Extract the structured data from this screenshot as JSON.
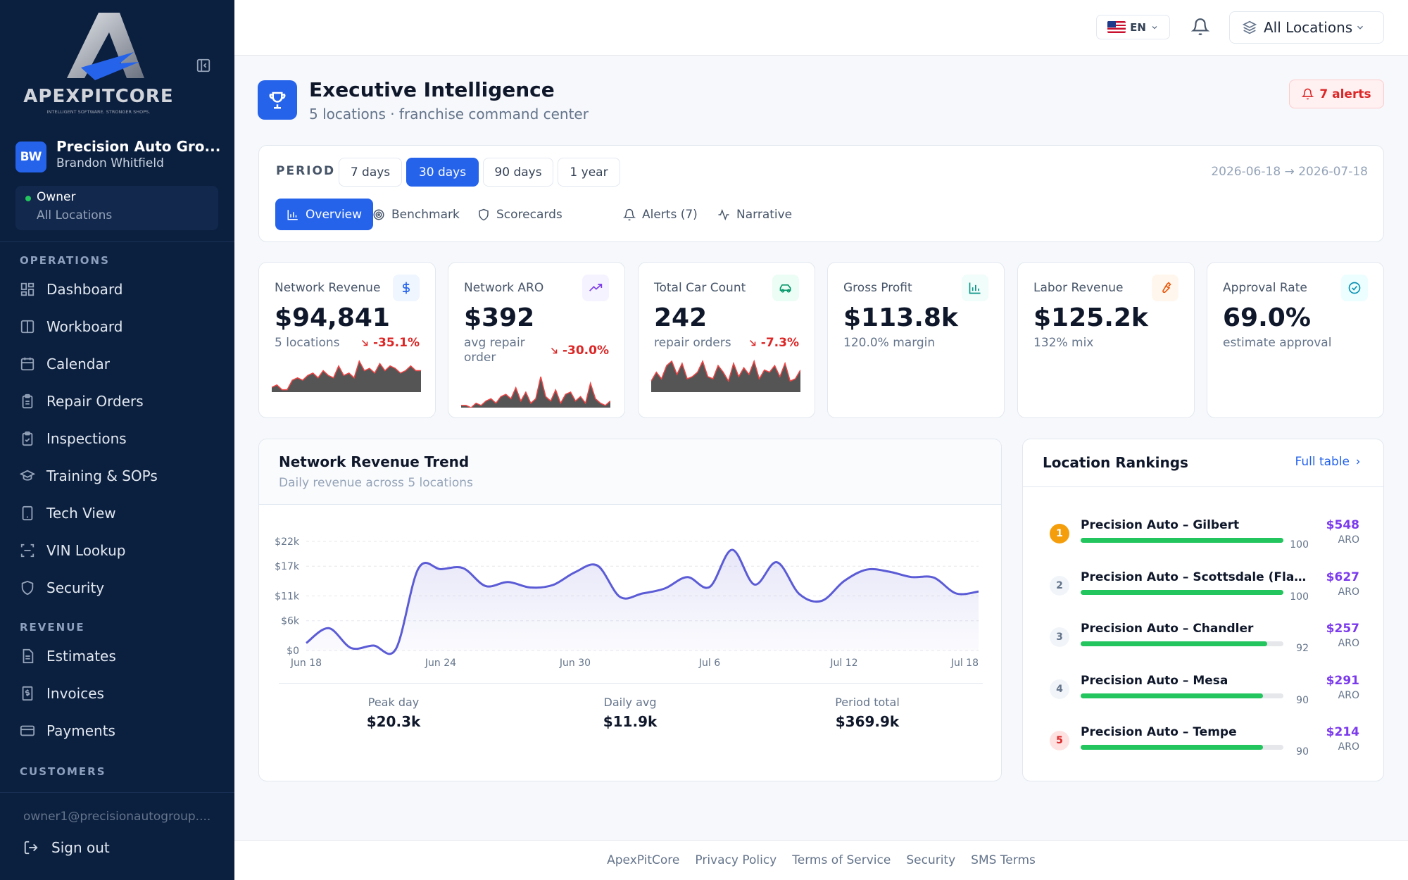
{
  "brand": {
    "name": "APEXPITCORE",
    "tagline": "INTELLIGENT SOFTWARE. STRONGER SHOPS."
  },
  "org": {
    "initials": "BW",
    "name": "Precision Auto Gro...",
    "user": "Brandon Whitfield",
    "role": "Owner",
    "scope": "All Locations"
  },
  "nav": {
    "operations_label": "OPERATIONS",
    "operations": [
      {
        "label": "Dashboard",
        "icon": "dashboard-icon"
      },
      {
        "label": "Workboard",
        "icon": "workboard-icon"
      },
      {
        "label": "Calendar",
        "icon": "calendar-icon"
      },
      {
        "label": "Repair Orders",
        "icon": "clipboard-icon"
      },
      {
        "label": "Inspections",
        "icon": "clipboard-check-icon"
      },
      {
        "label": "Training & SOPs",
        "icon": "graduation-cap-icon"
      },
      {
        "label": "Tech View",
        "icon": "tablet-icon"
      },
      {
        "label": "VIN Lookup",
        "icon": "scan-icon"
      },
      {
        "label": "Security",
        "icon": "shield-icon"
      }
    ],
    "revenue_label": "REVENUE",
    "revenue": [
      {
        "label": "Estimates",
        "icon": "document-icon"
      },
      {
        "label": "Invoices",
        "icon": "receipt-icon"
      },
      {
        "label": "Payments",
        "icon": "credit-card-icon"
      }
    ],
    "customers_label": "CUSTOMERS"
  },
  "account": {
    "email": "owner1@precisionautogroup....",
    "signout": "Sign out"
  },
  "topbar": {
    "lang": "EN",
    "locations": "All Locations"
  },
  "header": {
    "title": "Executive Intelligence",
    "subtitle": "5 locations · franchise command center",
    "alerts": "7 alerts"
  },
  "period": {
    "label": "PERIOD",
    "options": [
      "7 days",
      "30 days",
      "90 days",
      "1 year"
    ],
    "selected": "30 days",
    "range": "2026-06-18 → 2026-07-18"
  },
  "tabs": [
    {
      "label": "Overview",
      "active": true
    },
    {
      "label": "Benchmark"
    },
    {
      "label": "Scorecards"
    },
    {
      "label": "Alerts (7)"
    },
    {
      "label": "Narrative"
    }
  ],
  "kpis": [
    {
      "label": "Network Revenue",
      "value": "$94,841",
      "sub": "5 locations",
      "change": "-35.1%",
      "icon": "dollar-icon",
      "color": "#2563eb"
    },
    {
      "label": "Network ARO",
      "value": "$392",
      "sub": "avg repair order",
      "change": "-30.0%",
      "icon": "trending-up-icon",
      "color": "#7c3aed"
    },
    {
      "label": "Total Car Count",
      "value": "242",
      "sub": "repair orders",
      "change": "-7.3%",
      "icon": "car-icon",
      "color": "#059669"
    },
    {
      "label": "Gross Profit",
      "value": "$113.8k",
      "sub": "120.0% margin",
      "icon": "bar-chart-icon",
      "color": "#0d9488"
    },
    {
      "label": "Labor Revenue",
      "value": "$125.2k",
      "sub": "132% mix",
      "icon": "wrench-icon",
      "color": "#ea580c"
    },
    {
      "label": "Approval Rate",
      "value": "69.0%",
      "sub": "estimate approval",
      "icon": "check-circle-icon",
      "color": "#0891b2"
    }
  ],
  "sparklines": {
    "revenue": [
      2,
      3,
      1,
      1,
      5,
      6,
      5,
      7,
      8,
      6,
      9,
      7,
      6,
      11,
      7,
      8,
      6,
      13,
      9,
      10,
      8,
      12,
      9,
      11,
      10,
      8,
      9,
      11,
      9,
      9
    ],
    "aro": [
      1,
      1,
      0,
      2,
      1,
      3,
      4,
      2,
      5,
      6,
      4,
      9,
      3,
      7,
      2,
      4,
      14,
      5,
      3,
      8,
      2,
      6,
      7,
      3,
      5,
      2,
      11,
      4,
      2,
      1,
      3
    ],
    "cars": [
      5,
      9,
      6,
      12,
      14,
      8,
      13,
      6,
      7,
      9,
      14,
      7,
      6,
      12,
      9,
      5,
      13,
      7,
      11,
      8,
      14,
      6,
      10,
      9,
      12,
      7,
      13,
      5,
      6,
      10
    ]
  },
  "chart_data": {
    "type": "area",
    "title": "Network Revenue Trend",
    "subtitle": "Daily revenue across 5 locations",
    "x": [
      "Jun 18",
      "Jun 19",
      "Jun 20",
      "Jun 21",
      "Jun 22",
      "Jun 23",
      "Jun 24",
      "Jun 25",
      "Jun 26",
      "Jun 27",
      "Jun 28",
      "Jun 29",
      "Jun 30",
      "Jul 1",
      "Jul 2",
      "Jul 3",
      "Jul 4",
      "Jul 5",
      "Jul 6",
      "Jul 7",
      "Jul 8",
      "Jul 9",
      "Jul 10",
      "Jul 11",
      "Jul 12",
      "Jul 13",
      "Jul 14",
      "Jul 15",
      "Jul 16",
      "Jul 17",
      "Jul 18"
    ],
    "values": [
      1500,
      4500,
      500,
      1000,
      300,
      16500,
      16400,
      16600,
      13000,
      13800,
      12700,
      13200,
      15800,
      17100,
      10800,
      11500,
      12500,
      14800,
      12800,
      20300,
      13300,
      17800,
      11400,
      10000,
      14000,
      16300,
      15900,
      14800,
      14700,
      11500,
      11900
    ],
    "x_ticks": [
      "Jun 18",
      "Jun 24",
      "Jun 30",
      "Jul 6",
      "Jul 12",
      "Jul 18"
    ],
    "y_ticks": [
      "$0",
      "$6k",
      "$11k",
      "$17k",
      "$22k"
    ],
    "ylim": [
      0,
      22000
    ],
    "color": "#5b5bd6"
  },
  "trend_stats": [
    {
      "label": "Peak day",
      "value": "$20.3k"
    },
    {
      "label": "Daily avg",
      "value": "$11.9k"
    },
    {
      "label": "Period total",
      "value": "$369.9k"
    }
  ],
  "rankings": {
    "title": "Location Rankings",
    "link": "Full table",
    "aro_label": "ARO",
    "items": [
      {
        "rank": "1",
        "name": "Precision Auto – Gilbert",
        "score": 100,
        "aro": "$548"
      },
      {
        "rank": "2",
        "name": "Precision Auto – Scottsdale (Flag...",
        "score": 100,
        "aro": "$627"
      },
      {
        "rank": "3",
        "name": "Precision Auto – Chandler",
        "score": 92,
        "aro": "$257"
      },
      {
        "rank": "4",
        "name": "Precision Auto – Mesa",
        "score": 90,
        "aro": "$291"
      },
      {
        "rank": "5",
        "name": "Precision Auto – Tempe",
        "score": 90,
        "aro": "$214"
      }
    ]
  },
  "footer": [
    "ApexPitCore",
    "Privacy Policy",
    "Terms of Service",
    "Security",
    "SMS Terms"
  ]
}
